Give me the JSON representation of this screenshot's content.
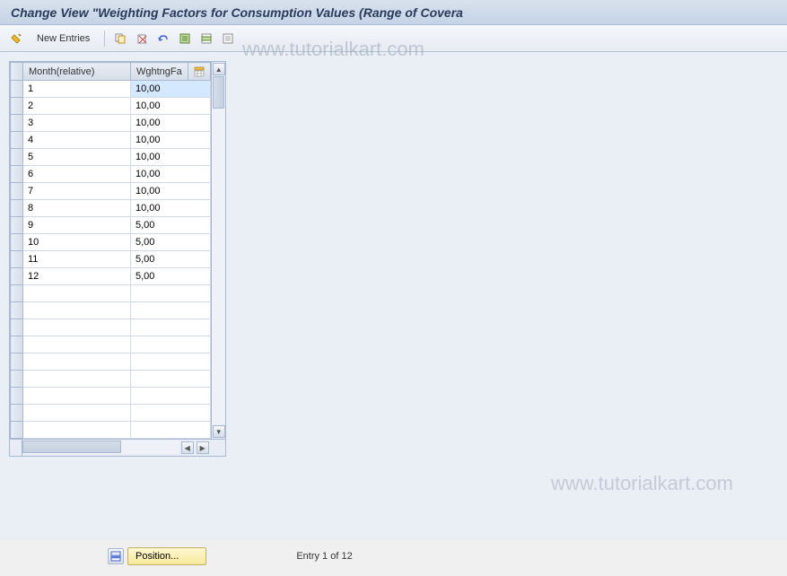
{
  "title": "Change View \"Weighting Factors for Consumption Values (Range of Covera",
  "toolbar": {
    "new_entries_label": "New Entries"
  },
  "grid": {
    "headers": {
      "month": "Month(relative)",
      "factor": "WghtngFa"
    },
    "rows": [
      {
        "month": "1",
        "factor": "10,00",
        "selected": true
      },
      {
        "month": "2",
        "factor": "10,00",
        "selected": false
      },
      {
        "month": "3",
        "factor": "10,00",
        "selected": false
      },
      {
        "month": "4",
        "factor": "10,00",
        "selected": false
      },
      {
        "month": "5",
        "factor": "10,00",
        "selected": false
      },
      {
        "month": "6",
        "factor": "10,00",
        "selected": false
      },
      {
        "month": "7",
        "factor": "10,00",
        "selected": false
      },
      {
        "month": "8",
        "factor": "10,00",
        "selected": false
      },
      {
        "month": "9",
        "factor": "5,00",
        "selected": false
      },
      {
        "month": "10",
        "factor": "5,00",
        "selected": false
      },
      {
        "month": "11",
        "factor": "5,00",
        "selected": false
      },
      {
        "month": "12",
        "factor": "5,00",
        "selected": false
      }
    ],
    "empty_rows": 9
  },
  "footer": {
    "position_label": "Position...",
    "entry_text": "Entry 1 of 12"
  },
  "watermark": "www.tutorialkart.com"
}
